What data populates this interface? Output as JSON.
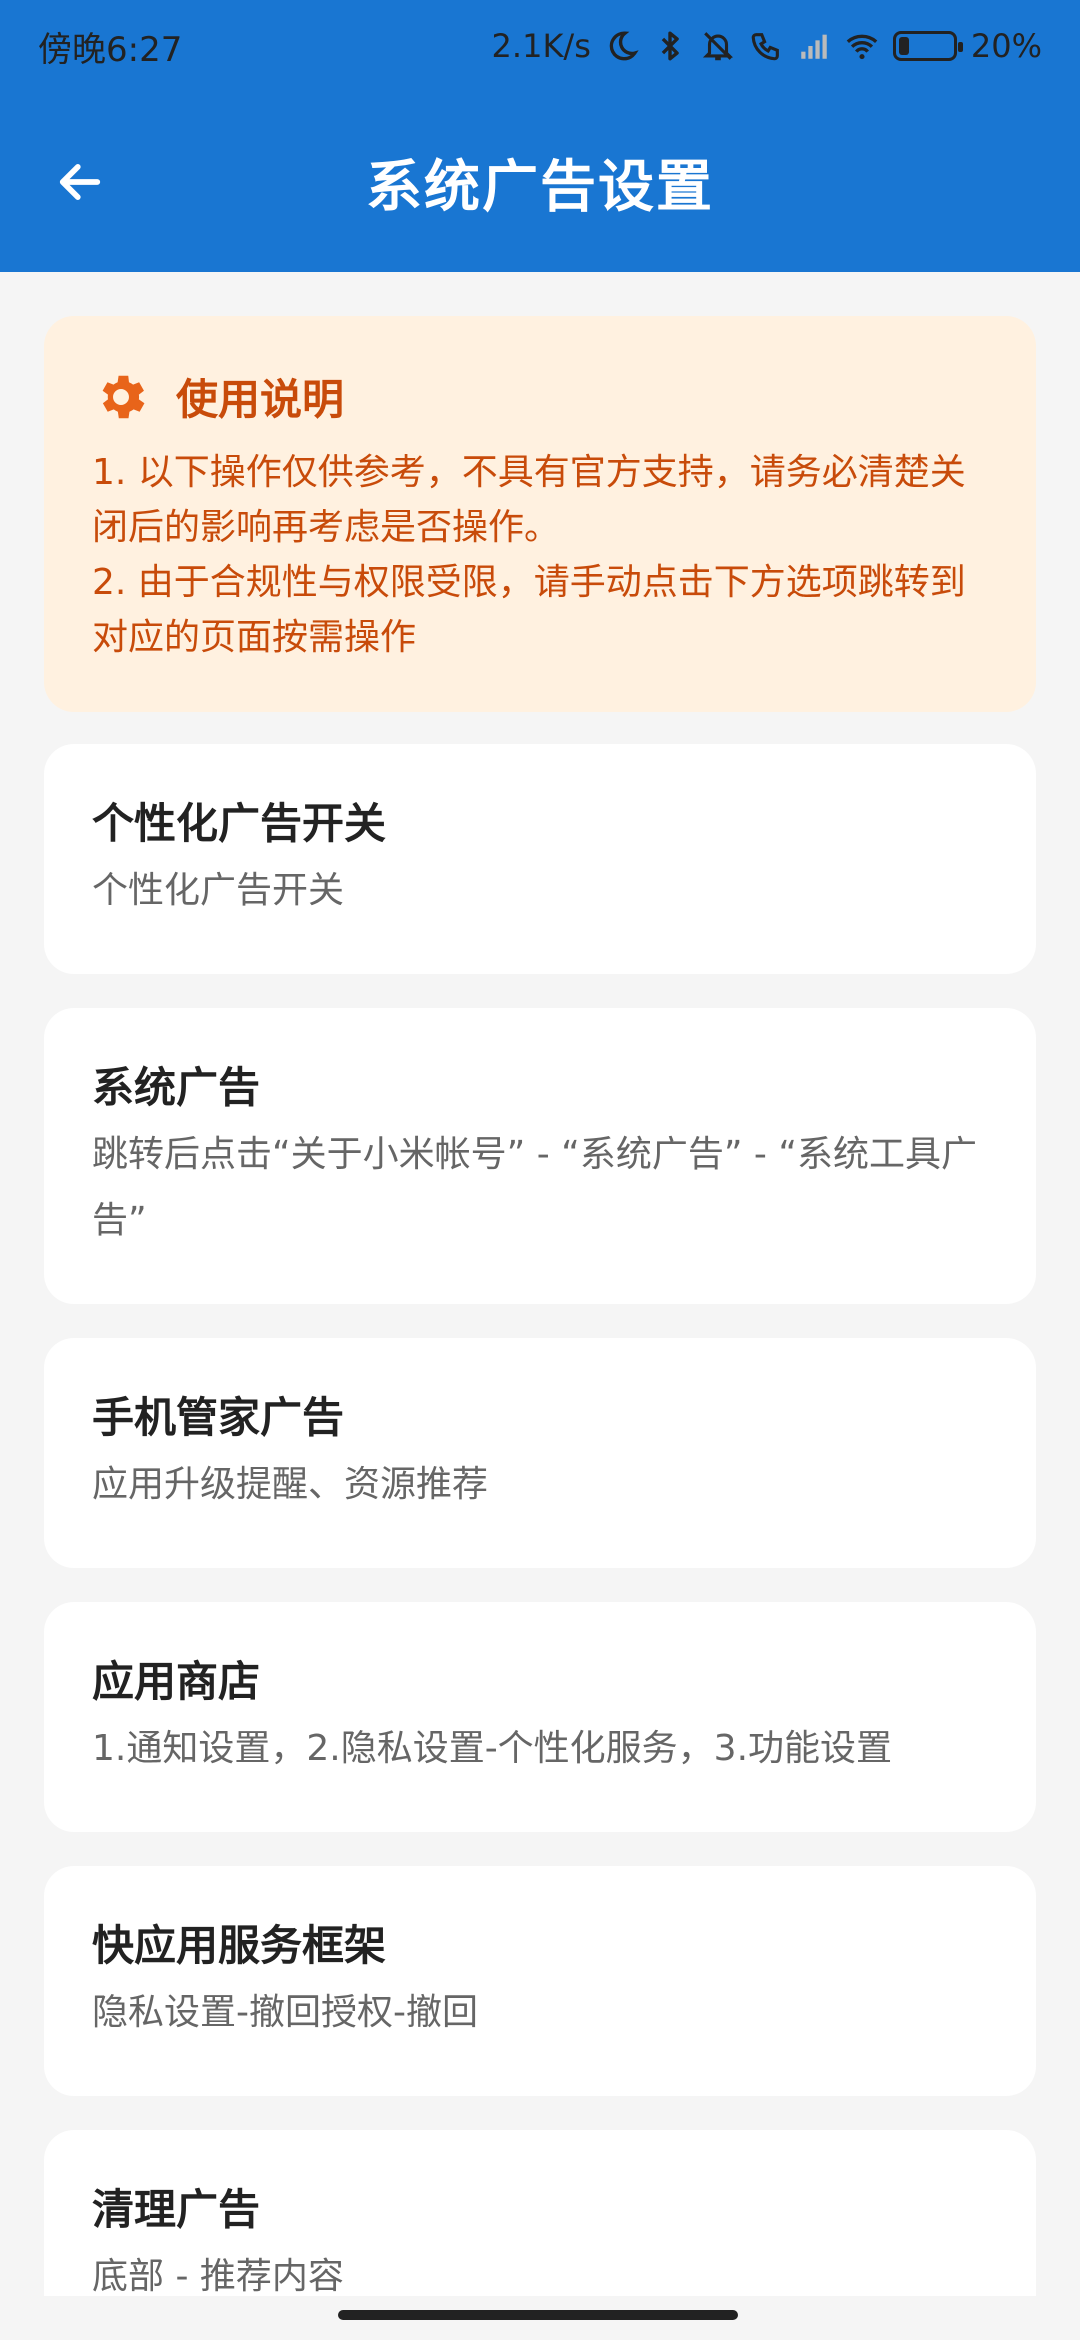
{
  "status": {
    "time": "傍晚6:27",
    "speed": "2.1K/s",
    "battery": "20%"
  },
  "header": {
    "title": "系统广告设置"
  },
  "notice": {
    "title": "使用说明",
    "line1": "1. 以下操作仅供参考，不具有官方支持，请务必清楚关闭后的影响再考虑是否操作。",
    "line2": "2. 由于合规性与权限受限，请手动点击下方选项跳转到对应的页面按需操作"
  },
  "cards": [
    {
      "title": "个性化广告开关",
      "subtitle": "个性化广告开关"
    },
    {
      "title": "系统广告",
      "subtitle": "跳转后点击“关于小米帐号” - “系统广告” - “系统工具广告”"
    },
    {
      "title": "手机管家广告",
      "subtitle": "应用升级提醒、资源推荐"
    },
    {
      "title": "应用商店",
      "subtitle": "1.通知设置，2.隐私设置-个性化服务，3.功能设置"
    },
    {
      "title": "快应用服务框架",
      "subtitle": "隐私设置-撤回授权-撤回"
    },
    {
      "title": "清理广告",
      "subtitle": "底部 - 推荐内容"
    }
  ],
  "colors": {
    "primary": "#1976d2",
    "notice_bg": "#fff1e0",
    "notice_text": "#c84b0a"
  }
}
